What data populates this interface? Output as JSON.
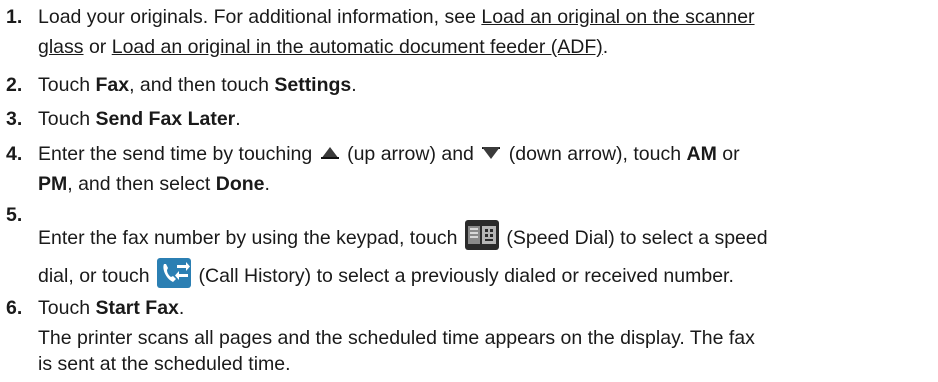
{
  "steps": [
    {
      "number": "1.",
      "text_a": "Load your originals. For additional information, see ",
      "link_1": "Load an original on the scanner",
      "link_1b": "glass",
      "text_b": " or ",
      "link_2": "Load an original in the automatic document feeder (ADF)",
      "text_c": "."
    },
    {
      "number": "2.",
      "text_a": "Touch ",
      "bold_1": "Fax",
      "text_b": ", and then touch ",
      "bold_2": "Settings",
      "text_c": "."
    },
    {
      "number": "3.",
      "text_a": "Touch ",
      "bold_1": "Send Fax Later",
      "text_b": "."
    },
    {
      "number": "4.",
      "text_a": "Enter the send time by touching ",
      "text_b": " (up arrow) and ",
      "text_c": " (down arrow), touch ",
      "bold_1": "AM",
      "text_d": " or",
      "bold_2": "PM",
      "text_e": ", and then select ",
      "bold_3": "Done",
      "text_f": "."
    },
    {
      "number": "5.",
      "text_a": "Enter the fax number by using the keypad, touch ",
      "text_b": " (Speed Dial) to select a speed",
      "text_c": "dial, or touch ",
      "text_d": " (Call History) to select a previously dialed or received number."
    },
    {
      "number": "6.",
      "text_a": "Touch ",
      "bold_1": "Start Fax",
      "text_b": ".",
      "para_1": "The printer scans all pages and the scheduled time appears on the display. The fax",
      "para_2": "is sent at the scheduled time."
    }
  ],
  "icons": {
    "up": "up-arrow-icon",
    "down": "down-arrow-icon",
    "speed_dial": "speed-dial-icon",
    "call_history": "call-history-icon"
  }
}
